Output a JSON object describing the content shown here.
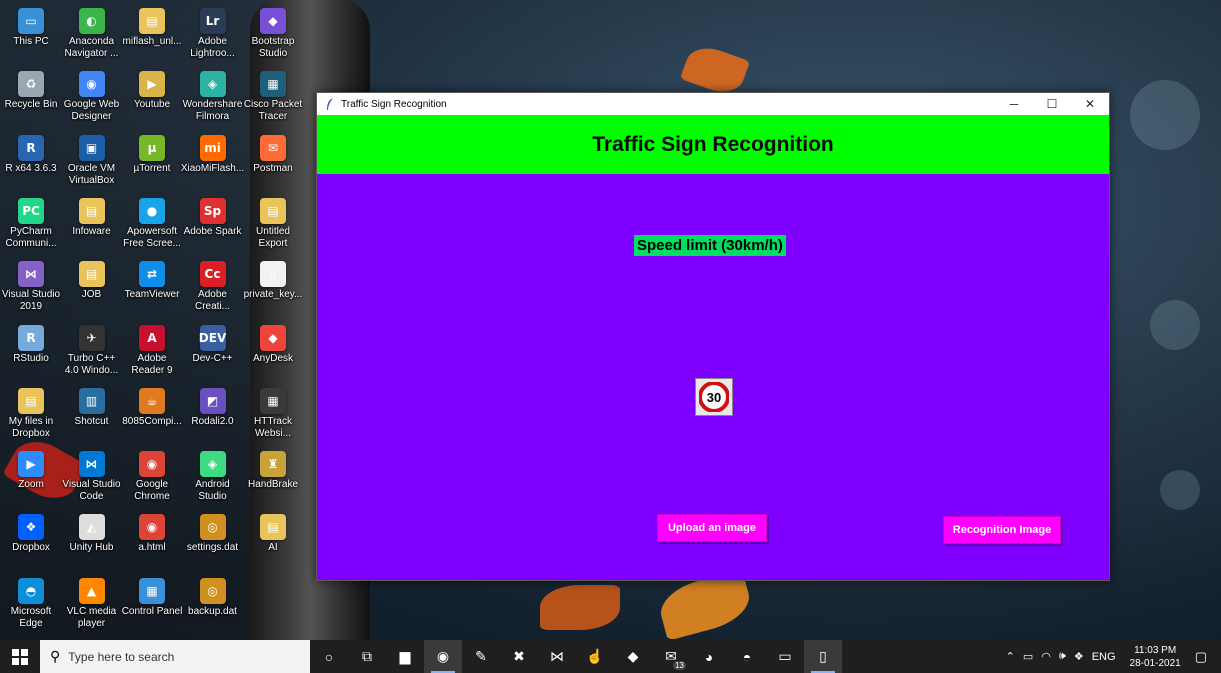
{
  "desktop": {
    "icons": [
      {
        "label": "This PC",
        "color": "#3a8fd9",
        "glyph": "▭"
      },
      {
        "label": "Anaconda Navigator ...",
        "color": "#3cb54a",
        "glyph": "◐"
      },
      {
        "label": "miflash_unl...",
        "color": "#e8c45a",
        "glyph": "▤"
      },
      {
        "label": "Adobe Lightroo...",
        "color": "#2b3a55",
        "glyph": "Lr"
      },
      {
        "label": "Bootstrap Studio",
        "color": "#7a4fd8",
        "glyph": "◆"
      },
      {
        "label": "Recycle Bin",
        "color": "#9aa6b0",
        "glyph": "♻"
      },
      {
        "label": "Google Web Designer",
        "color": "#4285f4",
        "glyph": "◉"
      },
      {
        "label": "Youtube",
        "color": "#d9b44a",
        "glyph": "▶"
      },
      {
        "label": "Wondershare Filmora",
        "color": "#2bb3a3",
        "glyph": "◈"
      },
      {
        "label": "Cisco Packet Tracer",
        "color": "#1f5f7a",
        "glyph": "▦"
      },
      {
        "label": "R x64 3.6.3",
        "color": "#2866b0",
        "glyph": "R"
      },
      {
        "label": "Oracle VM VirtualBox",
        "color": "#1b5fa8",
        "glyph": "▣"
      },
      {
        "label": "µTorrent",
        "color": "#76b82a",
        "glyph": "µ"
      },
      {
        "label": "XiaoMiFlash...",
        "color": "#ff6a00",
        "glyph": "mi"
      },
      {
        "label": "Postman",
        "color": "#ff6c37",
        "glyph": "✉"
      },
      {
        "label": "PyCharm Communi...",
        "color": "#21d789",
        "glyph": "PC"
      },
      {
        "label": "Infoware",
        "color": "#e8c45a",
        "glyph": "▤"
      },
      {
        "label": "Apowersoft Free Scree...",
        "color": "#1aa3e8",
        "glyph": "●"
      },
      {
        "label": "Adobe Spark",
        "color": "#e03030",
        "glyph": "Sp"
      },
      {
        "label": "Untitled Export",
        "color": "#e8c45a",
        "glyph": "▤"
      },
      {
        "label": "Visual Studio 2019",
        "color": "#8661c5",
        "glyph": "⋈"
      },
      {
        "label": "JOB",
        "color": "#e8c45a",
        "glyph": "▤"
      },
      {
        "label": "TeamViewer",
        "color": "#0e8ee9",
        "glyph": "⇄"
      },
      {
        "label": "Adobe Creati...",
        "color": "#da1f26",
        "glyph": "Cc"
      },
      {
        "label": "private_key...",
        "color": "#f2f2f2",
        "glyph": "▯"
      },
      {
        "label": "RStudio",
        "color": "#75aadb",
        "glyph": "R"
      },
      {
        "label": "Turbo C++ 4.0 Windo...",
        "color": "#333333",
        "glyph": "✈"
      },
      {
        "label": "Adobe Reader 9",
        "color": "#c8102e",
        "glyph": "A"
      },
      {
        "label": "Dev-C++",
        "color": "#3a5fa0",
        "glyph": "DEV"
      },
      {
        "label": "AnyDesk",
        "color": "#ef443b",
        "glyph": "◆"
      },
      {
        "label": "My files in Dropbox",
        "color": "#e8c45a",
        "glyph": "▤"
      },
      {
        "label": "Shotcut",
        "color": "#2a6ea0",
        "glyph": "▥"
      },
      {
        "label": "8085Compi...",
        "color": "#e07a1f",
        "glyph": "☕"
      },
      {
        "label": "Rodali2.0",
        "color": "#6a4fc0",
        "glyph": "◩"
      },
      {
        "label": "HTTrack Websi...",
        "color": "#3a3a3a",
        "glyph": "▦"
      },
      {
        "label": "Zoom",
        "color": "#2d8cff",
        "glyph": "▶"
      },
      {
        "label": "Visual Studio Code",
        "color": "#0078d4",
        "glyph": "⋈"
      },
      {
        "label": "Google Chrome",
        "color": "#db4437",
        "glyph": "◉"
      },
      {
        "label": "Android Studio",
        "color": "#3ddc84",
        "glyph": "◈"
      },
      {
        "label": "HandBrake",
        "color": "#c8a23a",
        "glyph": "♜"
      },
      {
        "label": "Dropbox",
        "color": "#0061ff",
        "glyph": "❖"
      },
      {
        "label": "Unity Hub",
        "color": "#dddddd",
        "glyph": "◭"
      },
      {
        "label": "a.html",
        "color": "#db4437",
        "glyph": "◉"
      },
      {
        "label": "settings.dat",
        "color": "#d09020",
        "glyph": "◎"
      },
      {
        "label": "AI",
        "color": "#e8c45a",
        "glyph": "▤"
      },
      {
        "label": "Microsoft Edge",
        "color": "#0c8fd6",
        "glyph": "◓"
      },
      {
        "label": "VLC media player",
        "color": "#ff8800",
        "glyph": "▲"
      },
      {
        "label": "Control Panel",
        "color": "#3a8fd9",
        "glyph": "▦"
      },
      {
        "label": "backup.dat",
        "color": "#d09020",
        "glyph": "◎"
      }
    ]
  },
  "window": {
    "title": "Traffic Sign Recognition",
    "minimize_glyph": "─",
    "maximize_glyph": "☐",
    "close_glyph": "✕",
    "banner_title": "Traffic Sign Recognition",
    "result_text": "Speed limit (30km/h)",
    "sign_value": "30",
    "upload_label": "Upload an image",
    "recognize_label": "Recognition Image",
    "colors": {
      "background": "#7f00ff",
      "banner": "#00ff00",
      "button": "#ff00ff",
      "result": "#00e060"
    }
  },
  "taskbar": {
    "search_placeholder": "Type here to search",
    "apps": [
      {
        "name": "cortana-icon",
        "glyph": "○",
        "active": false
      },
      {
        "name": "task-view-icon",
        "glyph": "⧉",
        "active": false
      },
      {
        "name": "file-explorer-icon",
        "glyph": "▆",
        "active": false
      },
      {
        "name": "chrome-icon",
        "glyph": "◉",
        "active": true
      },
      {
        "name": "notepadpp-icon",
        "glyph": "✎",
        "active": false
      },
      {
        "name": "xampp-icon",
        "glyph": "✖",
        "active": false
      },
      {
        "name": "visual-studio-icon",
        "glyph": "⋈",
        "active": false
      },
      {
        "name": "touch-icon",
        "glyph": "☝",
        "active": false
      },
      {
        "name": "game-icon",
        "glyph": "◆",
        "active": false
      },
      {
        "name": "mail-icon",
        "glyph": "✉",
        "active": false
      },
      {
        "name": "firefox-icon",
        "glyph": "◕",
        "active": false
      },
      {
        "name": "edge-icon",
        "glyph": "◓",
        "active": false
      },
      {
        "name": "terminal-icon",
        "glyph": "▭",
        "active": false
      },
      {
        "name": "python-window-icon",
        "glyph": "▯",
        "active": true
      }
    ],
    "mail_badge": "13",
    "language": "ENG",
    "time": "11:03 PM",
    "date": "28-01-2021"
  }
}
